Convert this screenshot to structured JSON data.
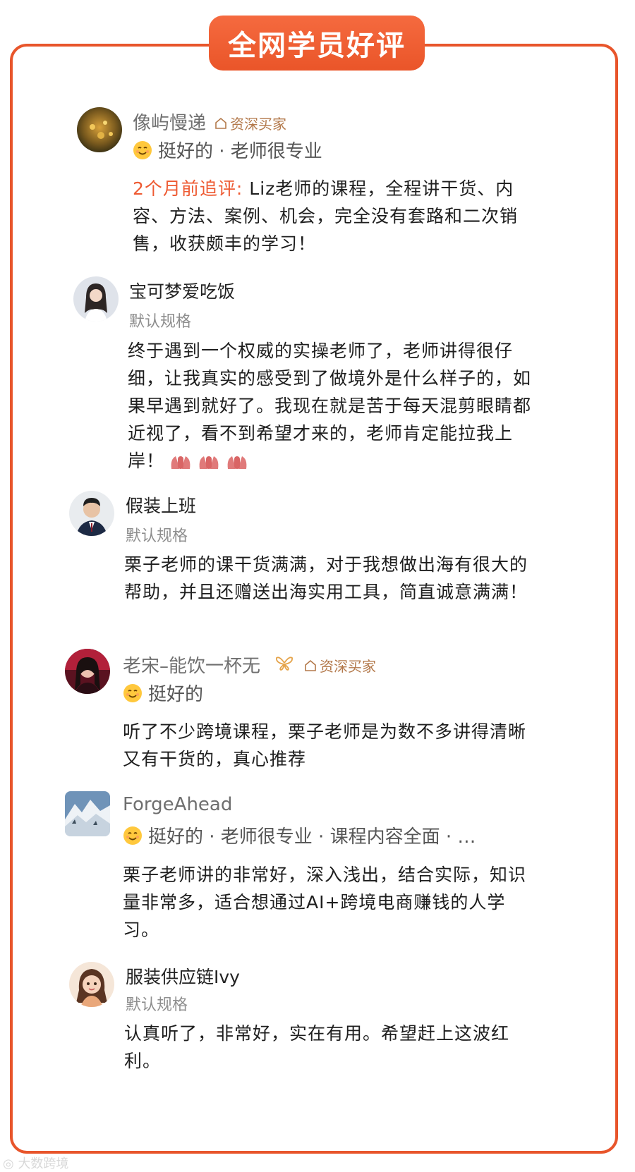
{
  "banner": {
    "title": "全网学员好评"
  },
  "reviews": [
    {
      "name": "像屿慢递",
      "badge": "资深买家",
      "tags": "挺好的 · 老师很专业",
      "followup_label": "2个月前追评:",
      "text": " Liz老师的课程，全程讲干货、内容、方法、案例、机会，完全没有套路和二次销售，收获颇丰的学习！"
    },
    {
      "name": "宝可梦爱吃饭",
      "spec": "默认规格",
      "text": "终于遇到一个权威的实操老师了，老师讲得很仔细，让我真实的感受到了做境外是什么样子的，如果早遇到就好了。我现在就是苦于每天混剪眼睛都近视了，看不到希望才来的，老师肯定能拉我上岸！"
    },
    {
      "name": "假装上班",
      "spec": "默认规格",
      "text": "栗子老师的课干货满满，对于我想做出海有很大的帮助，并且还赠送出海实用工具，简直诚意满满！"
    },
    {
      "name": "老宋–能饮一杯无",
      "badge": "资深买家",
      "tags": "挺好的",
      "text": "听了不少跨境课程，栗子老师是为数不多讲得清晰又有干货的，真心推荐"
    },
    {
      "name": "ForgeAhead",
      "tags": "挺好的 · 老师很专业 · 课程内容全面 · …",
      "text": "栗子老师讲的非常好，深入浅出，结合实际，知识量非常多，适合想通过AI+跨境电商赚钱的人学习。"
    },
    {
      "name": "服装供应链Ivy",
      "spec": "默认规格",
      "text": "认真听了，非常好，实在有用。希望赶上这波红利。"
    }
  ],
  "watermark": "大数跨境",
  "colors": {
    "accent": "#e8552b",
    "badge": "#b3794b",
    "followup": "#ee5a32"
  }
}
